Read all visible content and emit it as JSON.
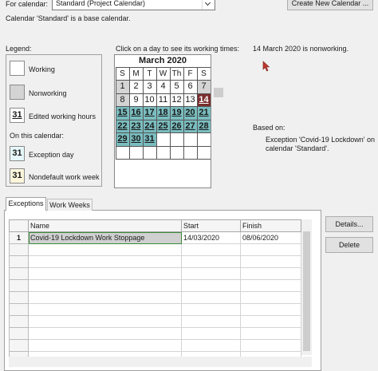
{
  "header": {
    "for_calendar_label": "For calendar:",
    "calendar_value": "Standard (Project Calendar)",
    "create_button": "Create New Calendar ...",
    "base_note": "Calendar 'Standard' is a base calendar."
  },
  "legend": {
    "title": "Legend:",
    "working": "Working",
    "nonworking": "Nonworking",
    "edited_glyph": "31",
    "edited": "Edited working hours",
    "on_this_calendar": "On this calendar:",
    "exception_glyph": "31",
    "exception": "Exception day",
    "nondefault_glyph": "31",
    "nondefault": "Nondefault work week"
  },
  "calendar": {
    "instruction": "Click on a day to see its working times:",
    "month": "March 2020",
    "days_of_week": [
      "S",
      "M",
      "T",
      "W",
      "Th",
      "F",
      "S"
    ],
    "days": [
      {
        "label": "1",
        "type": "nonworking"
      },
      {
        "label": "2",
        "type": "working"
      },
      {
        "label": "3",
        "type": "working"
      },
      {
        "label": "4",
        "type": "working"
      },
      {
        "label": "5",
        "type": "working"
      },
      {
        "label": "6",
        "type": "working"
      },
      {
        "label": "7",
        "type": "nonworking"
      },
      {
        "label": "8",
        "type": "nonworking"
      },
      {
        "label": "9",
        "type": "working"
      },
      {
        "label": "10",
        "type": "working"
      },
      {
        "label": "11",
        "type": "working"
      },
      {
        "label": "12",
        "type": "working"
      },
      {
        "label": "13",
        "type": "working"
      },
      {
        "label": "14",
        "type": "selected"
      },
      {
        "label": "15",
        "type": "exception"
      },
      {
        "label": "16",
        "type": "exception"
      },
      {
        "label": "17",
        "type": "exception"
      },
      {
        "label": "18",
        "type": "exception"
      },
      {
        "label": "19",
        "type": "exception"
      },
      {
        "label": "20",
        "type": "exception"
      },
      {
        "label": "21",
        "type": "exception"
      },
      {
        "label": "22",
        "type": "exception"
      },
      {
        "label": "23",
        "type": "exception"
      },
      {
        "label": "24",
        "type": "exception"
      },
      {
        "label": "25",
        "type": "exception"
      },
      {
        "label": "26",
        "type": "exception"
      },
      {
        "label": "27",
        "type": "exception"
      },
      {
        "label": "28",
        "type": "exception"
      },
      {
        "label": "29",
        "type": "exception"
      },
      {
        "label": "30",
        "type": "exception"
      },
      {
        "label": "31",
        "type": "exception"
      },
      {
        "label": "",
        "type": "blank"
      },
      {
        "label": "",
        "type": "blank"
      },
      {
        "label": "",
        "type": "blank"
      },
      {
        "label": "",
        "type": "blank"
      },
      {
        "label": "",
        "type": "blank"
      },
      {
        "label": "",
        "type": "blank"
      },
      {
        "label": "",
        "type": "blank"
      },
      {
        "label": "",
        "type": "blank"
      },
      {
        "label": "",
        "type": "blank"
      },
      {
        "label": "",
        "type": "blank"
      },
      {
        "label": "",
        "type": "blank"
      }
    ],
    "day_status": "14 March 2020 is nonworking.",
    "based_on_label": "Based on:",
    "based_on_detail": "Exception 'Covid-19 Lockdown' on calendar 'Standard'."
  },
  "tabs": {
    "exceptions": "Exceptions",
    "work_weeks": "Work Weeks"
  },
  "exceptions_table": {
    "columns": [
      "Name",
      "Start",
      "Finish"
    ],
    "rows": [
      {
        "num": "1",
        "name": "Covid-19 Lockdown Work Stoppage",
        "start": "14/03/2020",
        "finish": "08/06/2020"
      }
    ],
    "empty_rows": 10
  },
  "buttons": {
    "details": "Details...",
    "delete": "Delete"
  },
  "colors": {
    "exception_day": "#7abdc0",
    "selected_day": "#7b2e2e",
    "nonworking_day": "#d4d4d4",
    "cursor": "#c0392b"
  },
  "icons": {
    "cursor": "mouse-pointer-icon",
    "dropdown": "chevron-down-icon"
  }
}
